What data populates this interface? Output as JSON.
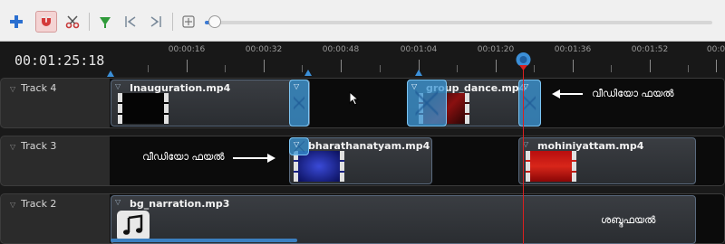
{
  "toolbar": {
    "buttons": [
      {
        "name": "add-track-button",
        "icon": "plus-icon"
      },
      {
        "name": "snap-toggle-button",
        "icon": "magnet-icon",
        "active": true
      },
      {
        "name": "razor-button",
        "icon": "scissors-icon"
      },
      {
        "name": "add-marker-button",
        "icon": "marker-icon"
      },
      {
        "name": "previous-marker-button",
        "icon": "previous-marker-icon"
      },
      {
        "name": "next-marker-button",
        "icon": "next-marker-icon"
      },
      {
        "name": "center-playhead-button",
        "icon": "center-timeline-icon"
      }
    ],
    "zoom_level": 0.02
  },
  "ruler": {
    "timecode": "00:01:25:18",
    "ticks": [
      "00:00:16",
      "00:00:32",
      "00:00:48",
      "00:01:04",
      "00:01:20",
      "00:01:36",
      "00:01:52",
      "00:0"
    ]
  },
  "tracks": [
    {
      "label": "Track 4",
      "clips": [
        {
          "title": "Inauguration.mp4"
        },
        {
          "title": "group_dance.mp4"
        }
      ],
      "annotation": "വീഡിയോ ഫയൽ"
    },
    {
      "label": "Track 3",
      "clips": [
        {
          "title": "bharathanatyam.mp4"
        },
        {
          "title": "mohiniyattam.mp4"
        }
      ],
      "annotation": "വീഡിയോ ഫയൽ"
    },
    {
      "label": "Track 2",
      "clips": [
        {
          "title": "bg_narration.mp3"
        }
      ],
      "annotation": "ശബ്ദഫയൽ"
    }
  ],
  "colors": {
    "transition": "#3894d4",
    "playhead": "#d92020",
    "clip_border": "#5a6a7e"
  }
}
